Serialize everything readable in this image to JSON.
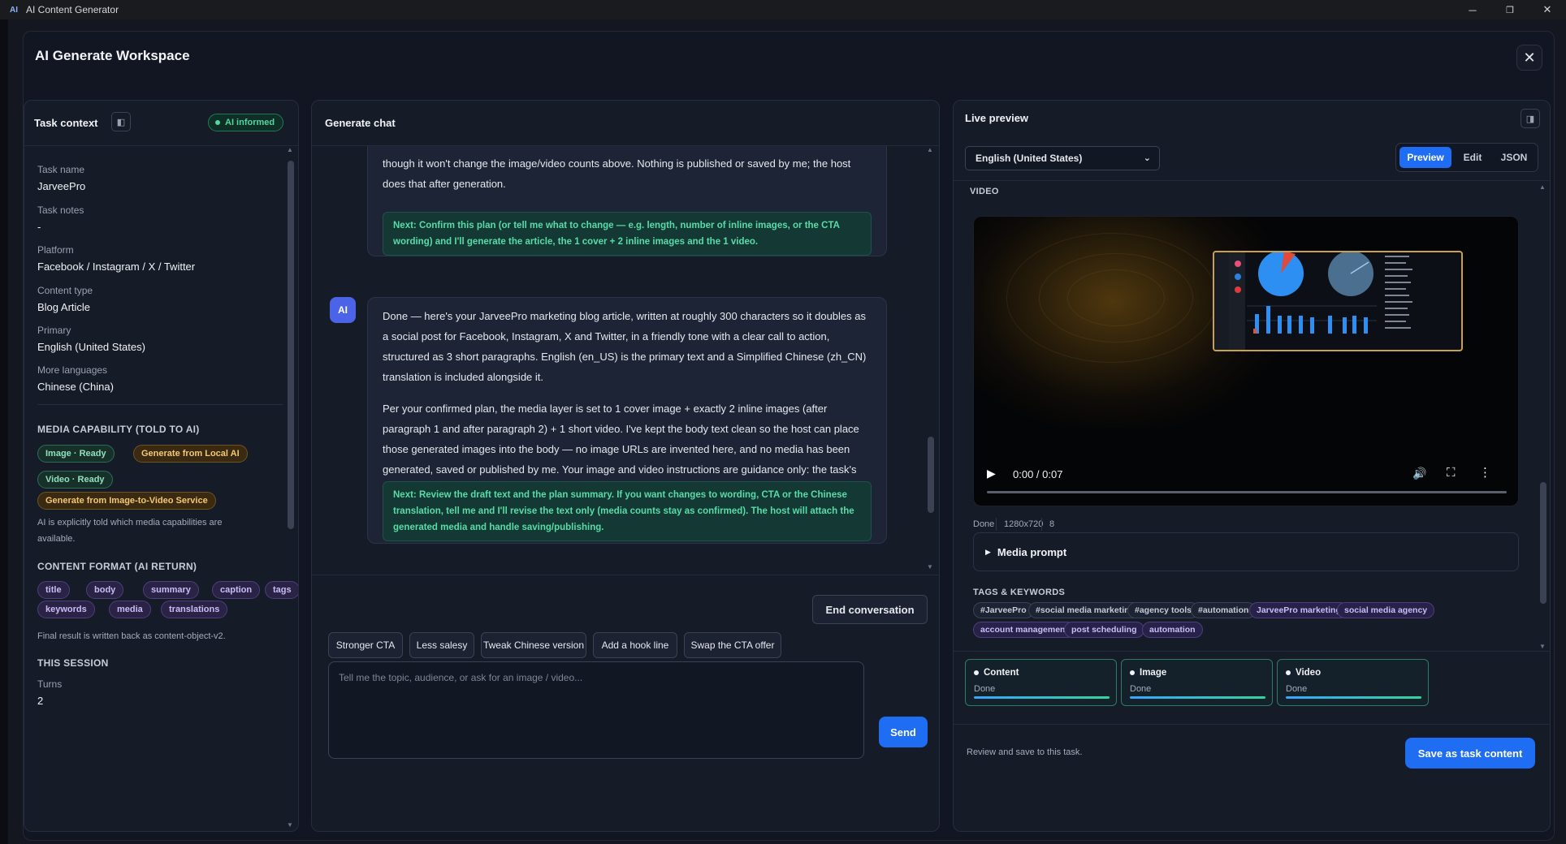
{
  "window": {
    "title": "AI Content Generator",
    "minimize": "─",
    "maximize": "❐",
    "close": "✕"
  },
  "workspace": {
    "title": "AI Generate Workspace",
    "close": "✕"
  },
  "left": {
    "title": "Task context",
    "badge": "AI informed",
    "fields": [
      {
        "label": "Task name",
        "value": "JarveePro"
      },
      {
        "label": "Task notes",
        "value": "-"
      },
      {
        "label": "Platform",
        "value": "Facebook / Instagram / X / Twitter"
      },
      {
        "label": "Content type",
        "value": "Blog Article"
      },
      {
        "label": "Primary",
        "value": "English (United States)"
      },
      {
        "label": "More languages",
        "value": "Chinese (China)"
      }
    ],
    "media_title": "MEDIA CAPABILITY (TOLD TO AI)",
    "media_chips": [
      "Image · Ready",
      "Generate from Local AI",
      "Video · Ready",
      "Generate from Image-to-Video Service"
    ],
    "media_note": "AI is explicitly told which media capabilities are available.",
    "format_title": "CONTENT FORMAT (AI RETURN)",
    "format_chips": [
      "title",
      "body",
      "summary",
      "caption",
      "tags",
      "keywords",
      "media",
      "translations"
    ],
    "format_note": "Final result is written back as content-object-v2.",
    "session_title": "THIS SESSION",
    "turns_label": "Turns",
    "turns_value": "2"
  },
  "chat": {
    "title": "Generate chat",
    "msg1_line1": "though it won't change the image/video counts above. Nothing is published or saved by me; the host",
    "msg1_line2": "does that after generation.",
    "msg1_next": "Next: Confirm this plan (or tell me what to change — e.g. length, number of inline images, or the CTA wording) and I'll generate the article, the 1 cover + 2 inline images and the 1 video.",
    "avatar": "AI",
    "msg2_p1": "Done — here's your JarveePro marketing blog article, written at roughly 300 characters so it doubles as a social post for Facebook, Instagram, X and Twitter, in a friendly tone with a clear call to action, structured as 3 short paragraphs. English (en_US) is the primary text and a Simplified Chinese (zh_CN) translation is included alongside it.",
    "msg2_p2": "Per your confirmed plan, the media layer is set to 1 cover image + exactly 2 inline images (after paragraph 1 and after paragraph 2) + 1 short video. I've kept the body text clean so the host can place those generated images into the body — no image URLs are invented here, and no media has been generated, saved or published by me. Your image and video instructions are guidance only: the task's configured services and rendering settings decide the final resolution, duration and visual style.",
    "msg2_next": "Next: Review the draft text and the plan summary. If you want changes to wording, CTA or the Chinese translation, tell me and I'll revise the text only (media counts stay as confirmed). The host will attach the generated media and handle saving/publishing.",
    "end_button": "End conversation",
    "quick": [
      "Stronger CTA",
      "Less salesy",
      "Tweak Chinese version",
      "Add a hook line",
      "Swap the CTA offer"
    ],
    "placeholder": "Tell me the topic, audience, or ask for an image / video...",
    "send": "Send"
  },
  "right": {
    "title": "Live preview",
    "language": "English (United States)",
    "tabs": [
      "Preview",
      "Edit",
      "JSON"
    ],
    "video_label": "VIDEO",
    "video_time": "0:00 / 0:07",
    "video_status": [
      "Done",
      "1280x720",
      "8"
    ],
    "media_prompt": "Media prompt",
    "tags_title": "TAGS & KEYWORDS",
    "tags": [
      "#JarveePro",
      "#social media marketing",
      "#agency tools",
      "#automation",
      "JarveePro marketing",
      "social media agency",
      "account management",
      "post scheduling",
      "automation"
    ],
    "status_cards": [
      {
        "title": "Content",
        "status": "Done"
      },
      {
        "title": "Image",
        "status": "Done"
      },
      {
        "title": "Video",
        "status": "Done"
      }
    ],
    "footer_note": "Review and save to this task.",
    "save_button": "Save as task content"
  },
  "colors": {
    "accent": "#1f6df2",
    "success": "#54d6a2",
    "bg": "#121622"
  }
}
